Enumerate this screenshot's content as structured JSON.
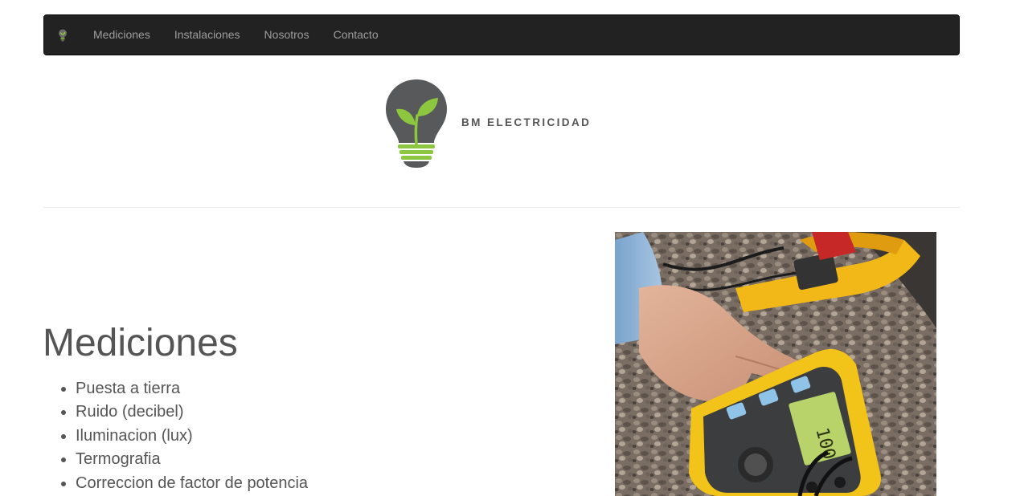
{
  "navbar": {
    "brand_icon": "lightbulb-leaf-icon",
    "items": [
      {
        "label": "Mediciones"
      },
      {
        "label": "Instalaciones"
      },
      {
        "label": "Nosotros"
      },
      {
        "label": "Contacto"
      }
    ]
  },
  "logo": {
    "text": "BM ELECTRICIDAD",
    "icon": "lightbulb-leaf-icon",
    "colors": {
      "bulb": "#58595b",
      "leaf": "#8dc63f"
    }
  },
  "main": {
    "title": "Mediciones",
    "items": [
      {
        "label": "Puesta a tierra"
      },
      {
        "label": "Ruido (decibel)"
      },
      {
        "label": "Iluminacion (lux)"
      },
      {
        "label": "Termografia"
      },
      {
        "label": "Correccion de factor de potencia"
      }
    ],
    "photo": "earth-ground-tester-photo"
  },
  "colors": {
    "navbar_bg": "#222222",
    "nav_text": "#9d9d9d",
    "body_text": "#555555"
  }
}
